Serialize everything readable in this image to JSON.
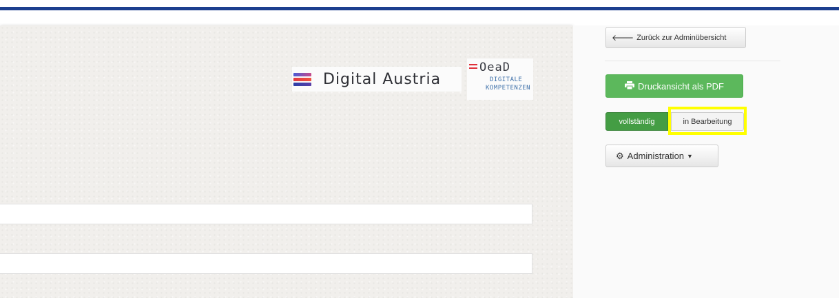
{
  "header": {
    "accent_color": "#1d3f8f"
  },
  "logos": {
    "digital_austria": {
      "text": "Digital Austria",
      "icon": "digital-austria-flag-logo"
    },
    "oead": {
      "line1": "OeaD",
      "line2": "DIGITALE",
      "line3": "KOMPETENZEN",
      "icon": "oead-logo"
    }
  },
  "form": {
    "field1_value": "",
    "field2_value": ""
  },
  "sidebar": {
    "back_label": "Zurück zur Adminübersicht",
    "back_icon": "arrow-left-icon",
    "pdf_label": "Druckansicht als PDF",
    "pdf_icon": "print-icon",
    "status_complete_label": "vollständig",
    "status_in_progress_label": "in Bearbeitung",
    "admin_label": "Administration",
    "admin_icon": "gear-icon",
    "colors": {
      "success": "#5cb85c",
      "success_active": "#449d44",
      "highlight": "#ffff00"
    }
  }
}
